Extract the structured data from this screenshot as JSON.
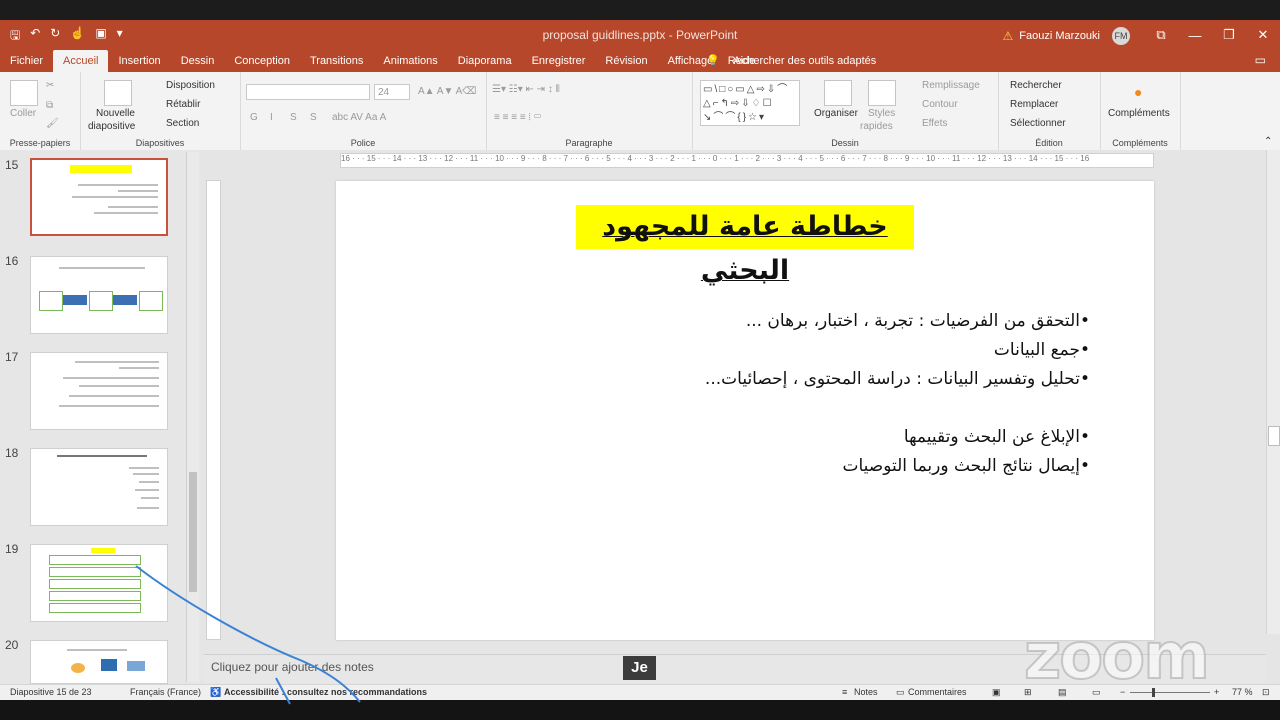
{
  "window": {
    "title": "proposal guidlines.pptx  -  PowerPoint",
    "user": "Faouzi Marzouki",
    "avatar_initials": "FM",
    "warning_icon": "warning-icon",
    "qat": [
      "save-icon",
      "undo-icon",
      "redo-icon",
      "touch-mode-icon",
      "present-icon",
      "customize-icon"
    ]
  },
  "ribbon": {
    "tabs": [
      "Fichier",
      "Accueil",
      "Insertion",
      "Dessin",
      "Conception",
      "Transitions",
      "Animations",
      "Diaporama",
      "Enregistrer",
      "Révision",
      "Affichage",
      "Aide"
    ],
    "active_tab": "Accueil",
    "tell_me": "Rechercher des outils adaptés",
    "groups": {
      "clipboard": {
        "label": "Presse-papiers",
        "paste": "Coller"
      },
      "slides": {
        "label": "Diapositives",
        "new_slide": "Nouvelle",
        "new_slide_2": "diapositive",
        "layout": "Disposition",
        "reset": "Rétablir",
        "section": "Section"
      },
      "font": {
        "label": "Police",
        "font_name": "",
        "font_size": "24",
        "bold": "G",
        "italic": "I",
        "underline": "S",
        "strike": "S"
      },
      "paragraph": {
        "label": "Paragraphe"
      },
      "drawing": {
        "label": "Dessin",
        "arrange": "Organiser",
        "styles": "Styles",
        "styles_2": "rapides",
        "fill": "Remplissage",
        "outline": "Contour",
        "effects": "Effets"
      },
      "editing": {
        "label": "Édition",
        "find": "Rechercher",
        "replace": "Remplacer",
        "select": "Sélectionner"
      },
      "addins": {
        "label": "Compléments",
        "button": "Compléments"
      }
    }
  },
  "thumbnails": [
    {
      "number": "15",
      "selected": true
    },
    {
      "number": "16",
      "selected": false
    },
    {
      "number": "17",
      "selected": false
    },
    {
      "number": "18",
      "selected": false
    },
    {
      "number": "19",
      "selected": false
    },
    {
      "number": "20",
      "selected": false
    }
  ],
  "ruler": {
    "marks": "16 · · · 15 · · · 14 · · · 13 · · · 12 · · · 11 · · · 10 · · · 9 · · · 8 · · · 7 · · · 6 · · · 5 · · · 4 · · · 3 · · · 2 · · · 1 · · · 0 · · · 1 · · · 2 · · · 3 · · · 4 · · · 5 · · · 6 · · · 7 · · · 8 · · · 9 · · · 10 · · · 11 · · · 12 · · · 13 · · · 14 · · · 15 · · · 16"
  },
  "slide": {
    "title": "خطاطة عامة للمجهود البحثي",
    "bullets": [
      "•التحقق من الفرضيات  : تجربة ، اختبار، برهان ...",
      "•جمع البيانات",
      "•تحليل وتفسير البيانات : دراسة المحتوى ، إحصائيات...",
      "",
      "•الإبلاغ عن البحث وتقييمها",
      "•إيصال نتائج البحث وربما التوصيات"
    ]
  },
  "notes": {
    "placeholder": "Cliquez pour ajouter des notes"
  },
  "overlay": {
    "speaker_label": "Je",
    "watermark": "zoom"
  },
  "status": {
    "slide_count": "Diapositive 15 de 23",
    "language": "Français (France)",
    "accessibility": "Accessibilité : consultez nos recommandations",
    "notes": "Notes",
    "comments": "Commentaires",
    "zoom": "77 %",
    "zoom_fraction": 0.77
  },
  "colors": {
    "accent": "#b7472a",
    "highlight": "#ffff00",
    "selected_thumb": "#c9513b",
    "annotation_stroke": "#3b82d6"
  }
}
